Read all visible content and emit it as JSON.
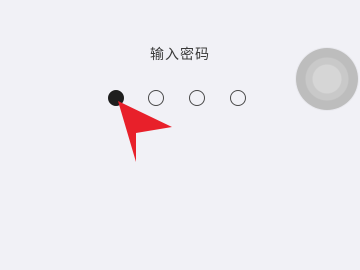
{
  "screen": {
    "title": "输入密码"
  },
  "passcode": {
    "total_digits": 4,
    "entered_digits": 1
  },
  "assistive_touch": {
    "icon": "assistive-touch-icon"
  },
  "cursor": {
    "icon": "red-pointer-icon",
    "color": "#e8202a"
  }
}
